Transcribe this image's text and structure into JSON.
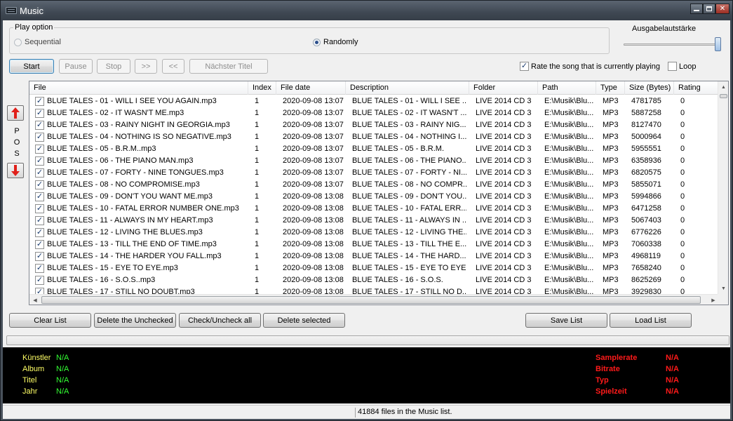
{
  "window": {
    "title": "Music",
    "minimize_glyph": "minimize-icon",
    "maximize_glyph": "maximize-icon",
    "close_glyph": "✕"
  },
  "play_option": {
    "legend": "Play option",
    "sequential_label": "Sequential",
    "randomly_label": "Randomly",
    "selected": "Randomly"
  },
  "volume": {
    "label": "Ausgabelautstärke",
    "level": 1.0
  },
  "controls": {
    "start": "Start",
    "pause": "Pause",
    "stop": "Stop",
    "forward": ">>",
    "back": "<<",
    "next_title": "Nächster Titel"
  },
  "options": {
    "rate_label": "Rate the song that is currently playing",
    "rate_checked": true,
    "loop_label": "Loop",
    "loop_checked": false
  },
  "pos_panel": {
    "letters": [
      "P",
      "O",
      "S"
    ]
  },
  "list": {
    "columns": [
      "File",
      "Index",
      "File date",
      "Description",
      "Folder",
      "Path",
      "Type",
      "Size (Bytes)",
      "Rating"
    ],
    "rows": [
      {
        "file": "BLUE TALES - 01 - WILL I SEE YOU AGAIN.mp3",
        "index": "1",
        "date": "2020-09-08 13:07",
        "description": "BLUE TALES - 01 - WILL I SEE ...",
        "folder": "LIVE 2014 CD 3",
        "path": "E:\\Musik\\Blu...",
        "type": "MP3",
        "size": "4781785",
        "rating": "0"
      },
      {
        "file": "BLUE TALES - 02 - IT WASN'T ME.mp3",
        "index": "1",
        "date": "2020-09-08 13:07",
        "description": "BLUE TALES - 02 - IT WASN'T ...",
        "folder": "LIVE 2014 CD 3",
        "path": "E:\\Musik\\Blu...",
        "type": "MP3",
        "size": "5887258",
        "rating": "0"
      },
      {
        "file": "BLUE TALES - 03 - RAINY NIGHT IN GEORGIA.mp3",
        "index": "1",
        "date": "2020-09-08 13:07",
        "description": "BLUE TALES - 03 - RAINY NIG...",
        "folder": "LIVE 2014 CD 3",
        "path": "E:\\Musik\\Blu...",
        "type": "MP3",
        "size": "8127470",
        "rating": "0"
      },
      {
        "file": "BLUE TALES - 04 - NOTHING IS SO NEGATIVE.mp3",
        "index": "1",
        "date": "2020-09-08 13:07",
        "description": "BLUE TALES - 04 - NOTHING I...",
        "folder": "LIVE 2014 CD 3",
        "path": "E:\\Musik\\Blu...",
        "type": "MP3",
        "size": "5000964",
        "rating": "0"
      },
      {
        "file": "BLUE TALES - 05 - B.R.M..mp3",
        "index": "1",
        "date": "2020-09-08 13:07",
        "description": "BLUE TALES - 05 - B.R.M.",
        "folder": "LIVE 2014 CD 3",
        "path": "E:\\Musik\\Blu...",
        "type": "MP3",
        "size": "5955551",
        "rating": "0"
      },
      {
        "file": "BLUE TALES - 06 - THE PIANO MAN.mp3",
        "index": "1",
        "date": "2020-09-08 13:07",
        "description": "BLUE TALES - 06 - THE PIANO...",
        "folder": "LIVE 2014 CD 3",
        "path": "E:\\Musik\\Blu...",
        "type": "MP3",
        "size": "6358936",
        "rating": "0"
      },
      {
        "file": "BLUE TALES - 07 - FORTY - NINE TONGUES.mp3",
        "index": "1",
        "date": "2020-09-08 13:07",
        "description": "BLUE TALES - 07 - FORTY - NI...",
        "folder": "LIVE 2014 CD 3",
        "path": "E:\\Musik\\Blu...",
        "type": "MP3",
        "size": "6820575",
        "rating": "0"
      },
      {
        "file": "BLUE TALES - 08 - NO COMPROMISE.mp3",
        "index": "1",
        "date": "2020-09-08 13:07",
        "description": "BLUE TALES - 08 - NO COMPR...",
        "folder": "LIVE 2014 CD 3",
        "path": "E:\\Musik\\Blu...",
        "type": "MP3",
        "size": "5855071",
        "rating": "0"
      },
      {
        "file": "BLUE TALES - 09 - DON'T YOU WANT ME.mp3",
        "index": "1",
        "date": "2020-09-08 13:08",
        "description": "BLUE TALES - 09 - DON'T YOU...",
        "folder": "LIVE 2014 CD 3",
        "path": "E:\\Musik\\Blu...",
        "type": "MP3",
        "size": "5994866",
        "rating": "0"
      },
      {
        "file": "BLUE TALES - 10 - FATAL ERROR NUMBER ONE.mp3",
        "index": "1",
        "date": "2020-09-08 13:08",
        "description": "BLUE TALES - 10 - FATAL ERR...",
        "folder": "LIVE 2014 CD 3",
        "path": "E:\\Musik\\Blu...",
        "type": "MP3",
        "size": "6471258",
        "rating": "0"
      },
      {
        "file": "BLUE TALES - 11 - ALWAYS IN MY HEART.mp3",
        "index": "1",
        "date": "2020-09-08 13:08",
        "description": "BLUE TALES - 11 - ALWAYS IN ...",
        "folder": "LIVE 2014 CD 3",
        "path": "E:\\Musik\\Blu...",
        "type": "MP3",
        "size": "5067403",
        "rating": "0"
      },
      {
        "file": "BLUE TALES - 12 - LIVING THE BLUES.mp3",
        "index": "1",
        "date": "2020-09-08 13:08",
        "description": "BLUE TALES - 12 - LIVING THE...",
        "folder": "LIVE 2014 CD 3",
        "path": "E:\\Musik\\Blu...",
        "type": "MP3",
        "size": "6776226",
        "rating": "0"
      },
      {
        "file": "BLUE TALES - 13 - TILL THE END OF TIME.mp3",
        "index": "1",
        "date": "2020-09-08 13:08",
        "description": "BLUE TALES - 13 - TILL THE E...",
        "folder": "LIVE 2014 CD 3",
        "path": "E:\\Musik\\Blu...",
        "type": "MP3",
        "size": "7060338",
        "rating": "0"
      },
      {
        "file": "BLUE TALES - 14 - THE HARDER YOU FALL.mp3",
        "index": "1",
        "date": "2020-09-08 13:08",
        "description": "BLUE TALES - 14 - THE HARD...",
        "folder": "LIVE 2014 CD 3",
        "path": "E:\\Musik\\Blu...",
        "type": "MP3",
        "size": "4968119",
        "rating": "0"
      },
      {
        "file": "BLUE TALES - 15 - EYE TO EYE.mp3",
        "index": "1",
        "date": "2020-09-08 13:08",
        "description": "BLUE TALES - 15 - EYE TO EYE",
        "folder": "LIVE 2014 CD 3",
        "path": "E:\\Musik\\Blu...",
        "type": "MP3",
        "size": "7658240",
        "rating": "0"
      },
      {
        "file": "BLUE TALES - 16 - S.O.S..mp3",
        "index": "1",
        "date": "2020-09-08 13:08",
        "description": "BLUE TALES - 16 - S.O.S.",
        "folder": "LIVE 2014 CD 3",
        "path": "E:\\Musik\\Blu...",
        "type": "MP3",
        "size": "8625269",
        "rating": "0"
      },
      {
        "file": "BLUE TALES - 17 - STILL NO DOUBT.mp3",
        "index": "1",
        "date": "2020-09-08 13:08",
        "description": "BLUE TALES - 17 - STILL NO D...",
        "folder": "LIVE 2014 CD 3",
        "path": "E:\\Musik\\Blu...",
        "type": "MP3",
        "size": "3929830",
        "rating": "0"
      }
    ]
  },
  "list_buttons": {
    "clear": "Clear List",
    "delete_unchecked": "Delete the Unchecked",
    "check_all": "Check/Uncheck all",
    "delete_selected": "Delete selected",
    "save": "Save List",
    "load": "Load List"
  },
  "info": {
    "artist_label": "Künstler",
    "artist_value": "N/A",
    "album_label": "Album",
    "album_value": "N/A",
    "title_label": "Titel",
    "title_value": "N/A",
    "year_label": "Jahr",
    "year_value": "N/A",
    "samplerate_label": "Samplerate",
    "samplerate_value": "N/A",
    "bitrate_label": "Bitrate",
    "bitrate_value": "N/A",
    "type_label": "Typ",
    "type_value": "N/A",
    "playtime_label": "Spielzeit",
    "playtime_value": "N/A"
  },
  "status": {
    "text": "41884 files in the Music list."
  },
  "colors": {
    "info_background": "#000000",
    "info_label_left": "#ffff66",
    "info_value_left": "#33ff33",
    "info_right": "#ff1a1a",
    "arrow_red": "#e0201a"
  }
}
